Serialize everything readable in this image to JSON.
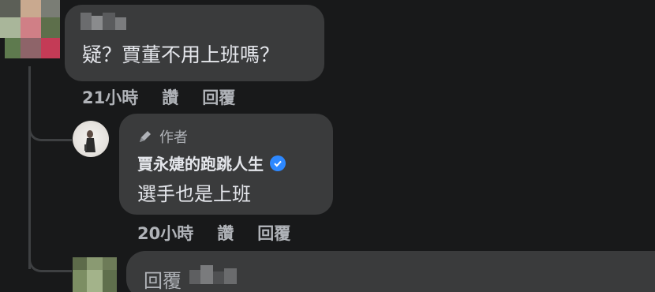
{
  "comments": [
    {
      "text": "疑？賈董不用上班嗎？",
      "time": "21小時",
      "like_label": "讚",
      "reply_label": "回覆"
    }
  ],
  "reply": {
    "author_badge": "作者",
    "author_name": "賈永婕的跑跳人生",
    "text": "選手也是上班",
    "time": "20小時",
    "like_label": "讚",
    "reply_label": "回覆",
    "verified_icon": "verified-check-icon"
  },
  "reply_input": {
    "placeholder": "回覆"
  },
  "colors": {
    "background": "#18191a",
    "bubble": "#3a3b3c",
    "text": "#e4e6eb",
    "secondary_text": "#b0b3b8",
    "verified": "#2d88ff"
  }
}
